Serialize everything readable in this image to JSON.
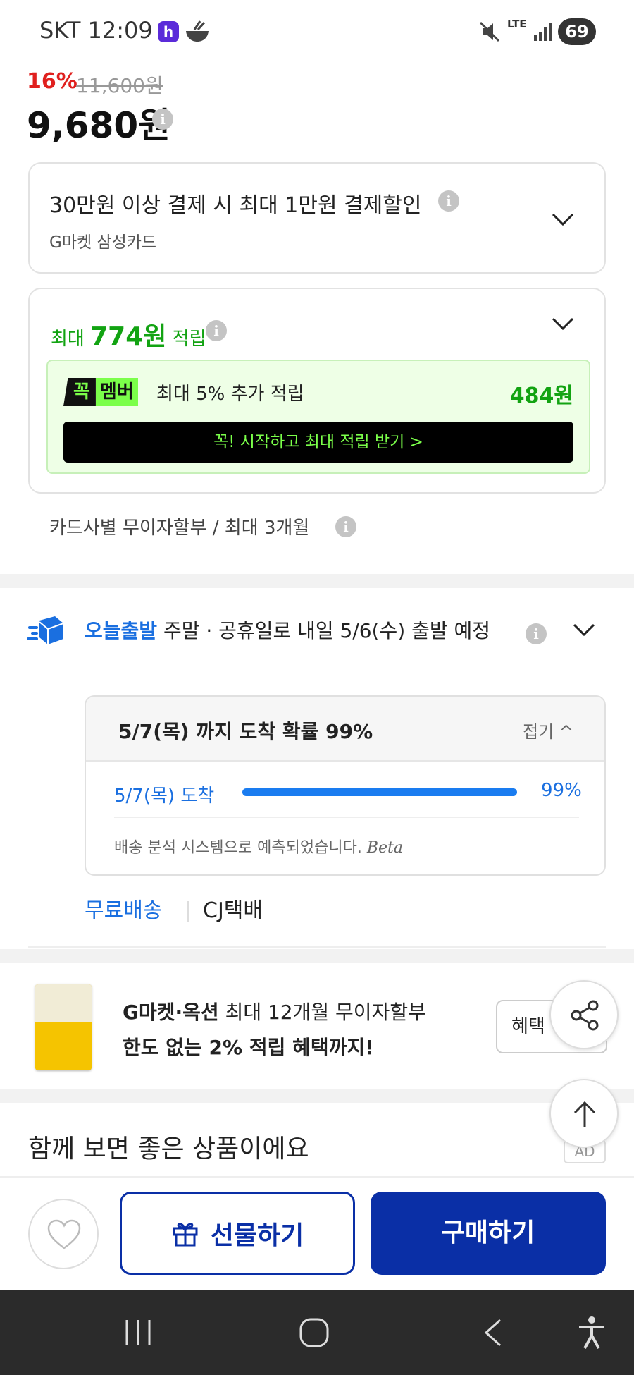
{
  "status_bar": {
    "carrier_time": "SKT 12:09",
    "app_badge": "h",
    "network": "LTE",
    "battery": "69"
  },
  "price": {
    "discount": "16%",
    "original": "11,600원",
    "current": "9,680원"
  },
  "card_discount": {
    "title": "30만원 이상 결제 시 최대 1만원 결제할인",
    "subtitle": "G마켓 삼성카드"
  },
  "points": {
    "prefix": "최대 ",
    "amount": "774원",
    "suffix": " 적립",
    "member_logo_1": "꼭",
    "member_logo_2": "멤버",
    "member_text": "최대 5% 추가 적립",
    "member_amount": "484원",
    "member_button": "꼭! 시작하고 최대 적립 받기  >"
  },
  "installment": "카드사별 무이자할부 / 최대 3개월",
  "delivery": {
    "brand": "오늘출발",
    "message": " 주말 · 공휴일로 내일 5/6(수) 출발 예정",
    "probability_title": "5/7(목) 까지 도착 확률 99%",
    "fold_label": "접기 ^",
    "arrival_date": "5/7(목) 도착",
    "arrival_pct": "99%",
    "arrival_fraction": 0.99,
    "note": "배송 분석 시스템으로 예측되었습니다.",
    "beta": "Beta",
    "shipping_fee": "무료배송",
    "carrier": "CJ택배"
  },
  "promo": {
    "line1_bold": "G마켓·옥션",
    "line1_rest": " 최대 12개월 무이자할부",
    "line2": "한도 없는 2% 적립 혜택까지!",
    "button": "혜택"
  },
  "recommend": {
    "title": "함께 보면 좋은 상품이에요",
    "ad_badge": "AD"
  },
  "actions": {
    "gift": "선물하기",
    "buy": "구매하기"
  },
  "icons": [
    "info-icon",
    "chevron-down-icon",
    "truck-icon",
    "share-icon",
    "arrow-up-icon",
    "heart-icon",
    "gift-icon"
  ],
  "colors": {
    "brand_blue": "#0a2fa6",
    "link_blue": "#1a6fe0",
    "point_green": "#12a312",
    "sale_red": "#e0201e"
  }
}
